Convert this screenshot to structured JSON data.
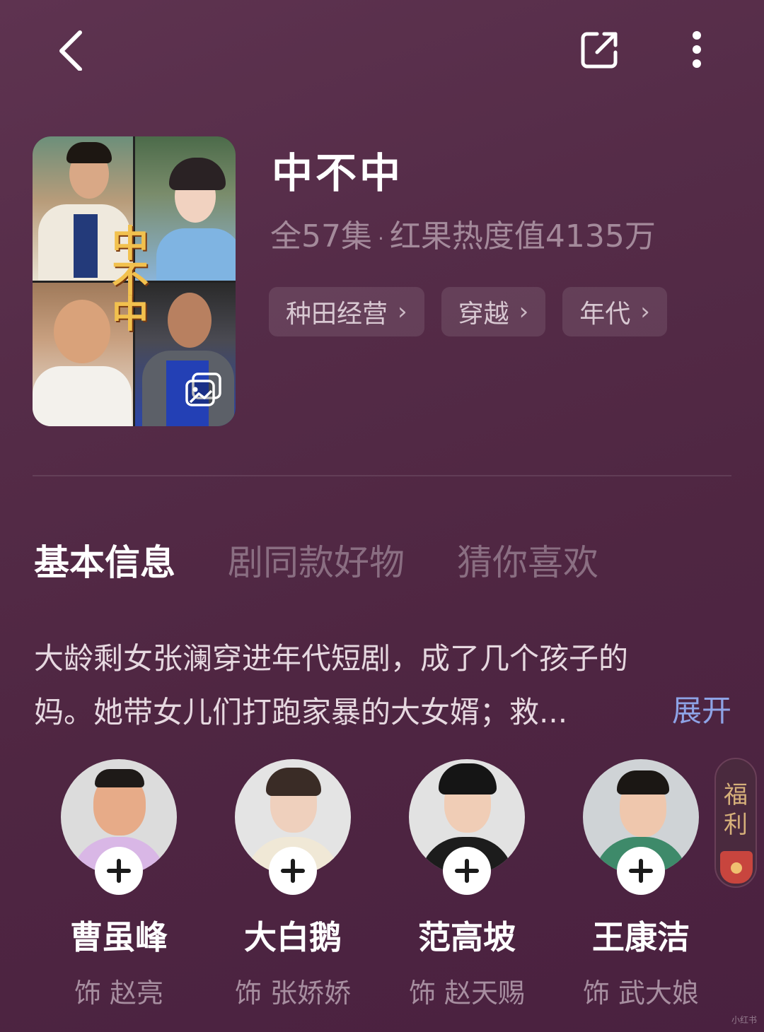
{
  "header": {
    "back_icon": "chevron-left-icon",
    "share_icon": "share-external-icon",
    "more_icon": "more-vertical-icon"
  },
  "drama": {
    "poster_text": "中不中",
    "title": "中不中",
    "episodes": "全57集",
    "separator": "·",
    "heat": "红果热度值4135万",
    "tags": [
      {
        "label": "种田经营",
        "chev": "›"
      },
      {
        "label": "穿越",
        "chev": "›"
      },
      {
        "label": "年代",
        "chev": "›"
      }
    ]
  },
  "tabs": [
    {
      "label": "基本信息",
      "active": true
    },
    {
      "label": "剧同款好物",
      "active": false
    },
    {
      "label": "猜你喜欢",
      "active": false
    }
  ],
  "synopsis": {
    "text": "大龄剩女张澜穿进年代短剧，成了几个孩子的妈。她带女儿们打跑家暴的大女婿；救...",
    "expand_label": "展开"
  },
  "cast": [
    {
      "name": "曹虽峰",
      "role": "饰 赵亮"
    },
    {
      "name": "大白鹅",
      "role": "饰 张娇娇"
    },
    {
      "name": "范高坡",
      "role": "饰 赵天赐"
    },
    {
      "name": "王康洁",
      "role": "饰 武大娘"
    }
  ],
  "welfare": {
    "label": "福利"
  },
  "watermark": "小红书"
}
